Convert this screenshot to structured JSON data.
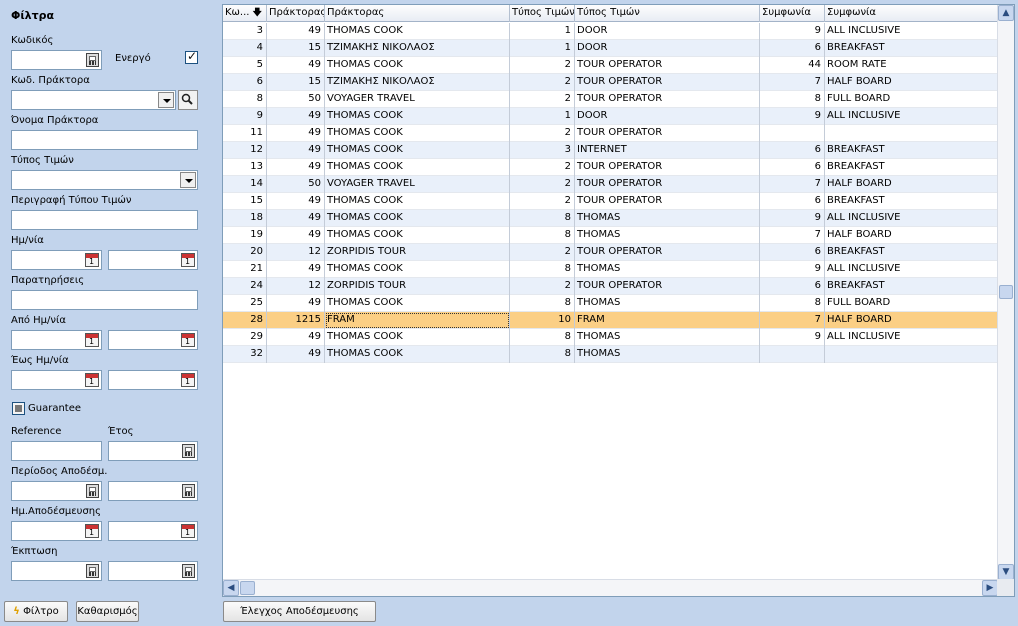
{
  "filter": {
    "title": "Φίλτρα",
    "code_label": "Κωδικός",
    "active_label": "Ενεργό",
    "active_checked": true,
    "agent_code_label": "Κωδ. Πράκτορα",
    "agent_name_label": "Όνομα Πράκτορα",
    "price_type_label": "Τύπος Τιμών",
    "price_type_desc_label": "Περιγραφή Τύπου Τιμών",
    "date_label": "Ημ/νία",
    "notes_label": "Παρατηρήσεις",
    "from_date_label": "Από Ημ/νία",
    "to_date_label": "Έως Ημ/νία",
    "guarantee_label": "Guarantee",
    "reference_label": "Reference",
    "year_label": "Έτος",
    "release_period_label": "Περίοδος Αποδέσμ.",
    "release_date_label": "Ημ.Αποδέσμευσης",
    "discount_label": "Έκπτωση",
    "filter_button": "Φίλτρο",
    "clear_button": "Καθαρισμός"
  },
  "bottom": {
    "release_check_button": "Έλεγχος Αποδέσμευσης"
  },
  "grid": {
    "columns": [
      "Κω...",
      "Πράκτορας",
      "Πράκτορας",
      "Τύπος Τιμών",
      "Τύπος Τιμών",
      "Συμφωνία",
      "Συμφωνία"
    ],
    "selected_row": 17,
    "rows": [
      [
        "3",
        "49",
        "THOMAS COOK",
        "1",
        "DOOR",
        "9",
        "ALL INCLUSIVE"
      ],
      [
        "4",
        "15",
        "ΤΖΙΜΑΚΗΣ ΝΙΚΟΛΑΟΣ",
        "1",
        "DOOR",
        "6",
        "BREAKFAST"
      ],
      [
        "5",
        "49",
        "THOMAS COOK",
        "2",
        "TOUR OPERATOR",
        "44",
        "ROOM RATE"
      ],
      [
        "6",
        "15",
        "ΤΖΙΜΑΚΗΣ ΝΙΚΟΛΑΟΣ",
        "2",
        "TOUR OPERATOR",
        "7",
        "HALF BOARD"
      ],
      [
        "8",
        "50",
        "VOYAGER TRAVEL",
        "2",
        "TOUR OPERATOR",
        "8",
        "FULL BOARD"
      ],
      [
        "9",
        "49",
        "THOMAS COOK",
        "1",
        "DOOR",
        "9",
        "ALL INCLUSIVE"
      ],
      [
        "11",
        "49",
        "THOMAS COOK",
        "2",
        "TOUR OPERATOR",
        "",
        ""
      ],
      [
        "12",
        "49",
        "THOMAS COOK",
        "3",
        "INTERNET",
        "6",
        "BREAKFAST"
      ],
      [
        "13",
        "49",
        "THOMAS COOK",
        "2",
        "TOUR OPERATOR",
        "6",
        "BREAKFAST"
      ],
      [
        "14",
        "50",
        "VOYAGER TRAVEL",
        "2",
        "TOUR OPERATOR",
        "7",
        "HALF BOARD"
      ],
      [
        "15",
        "49",
        "THOMAS COOK",
        "2",
        "TOUR OPERATOR",
        "6",
        "BREAKFAST"
      ],
      [
        "18",
        "49",
        "THOMAS COOK",
        "8",
        "THOMAS",
        "9",
        "ALL INCLUSIVE"
      ],
      [
        "19",
        "49",
        "THOMAS COOK",
        "8",
        "THOMAS",
        "7",
        "HALF BOARD"
      ],
      [
        "20",
        "12",
        "ZORPIDIS TOUR",
        "2",
        "TOUR OPERATOR",
        "6",
        "BREAKFAST"
      ],
      [
        "21",
        "49",
        "THOMAS COOK",
        "8",
        "THOMAS",
        "9",
        "ALL INCLUSIVE"
      ],
      [
        "24",
        "12",
        "ZORPIDIS TOUR",
        "2",
        "TOUR OPERATOR",
        "6",
        "BREAKFAST"
      ],
      [
        "25",
        "49",
        "THOMAS COOK",
        "8",
        "THOMAS",
        "8",
        "FULL BOARD"
      ],
      [
        "28",
        "1215",
        "FRAM",
        "10",
        "FRAM",
        "7",
        "HALF BOARD"
      ],
      [
        "29",
        "49",
        "THOMAS COOK",
        "8",
        "THOMAS",
        "9",
        "ALL INCLUSIVE"
      ],
      [
        "32",
        "49",
        "THOMAS COOK",
        "8",
        "THOMAS",
        "",
        ""
      ]
    ]
  },
  "colors": {
    "panel_bg": "#c2d4ec",
    "selected_row": "#fbcf85",
    "alt_row": "#e9f0fa"
  }
}
